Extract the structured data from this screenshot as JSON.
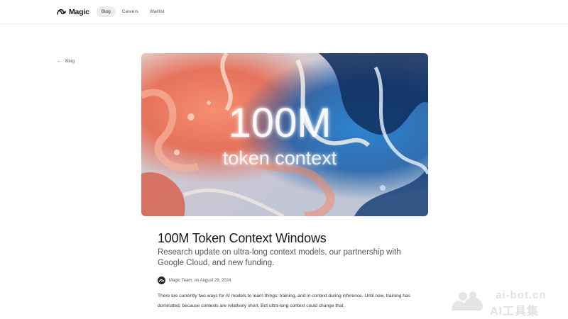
{
  "nav": {
    "brand": "Magic",
    "links": [
      {
        "label": "Blog",
        "active": true
      },
      {
        "label": "Careers",
        "active": false
      },
      {
        "label": "Waitlist",
        "active": false
      }
    ]
  },
  "back": {
    "arrow": "←",
    "label": "Blog",
    "icon": "arrow-left-icon"
  },
  "hero": {
    "headline": "100M",
    "subline": "token context",
    "colors": {
      "coral": "#ee7759",
      "blue": "#1f6fb8",
      "navy": "#0e2a55",
      "cream": "#f1e6da"
    }
  },
  "article": {
    "title": "100M Token Context Windows",
    "subtitle": "Research update on ultra-long context models, our partnership with Google Cloud, and new funding.",
    "byline": "Magic Team, on August 29, 2024",
    "paragraphs": [
      "There are currently two ways for AI models to learn things: training, and in-context during inference. Until now, training has dominated, because contexts are relatively short. But ultra-long context could change that."
    ]
  },
  "watermark": {
    "top": "ai-bot.cn",
    "bottom": "AI工具集"
  }
}
